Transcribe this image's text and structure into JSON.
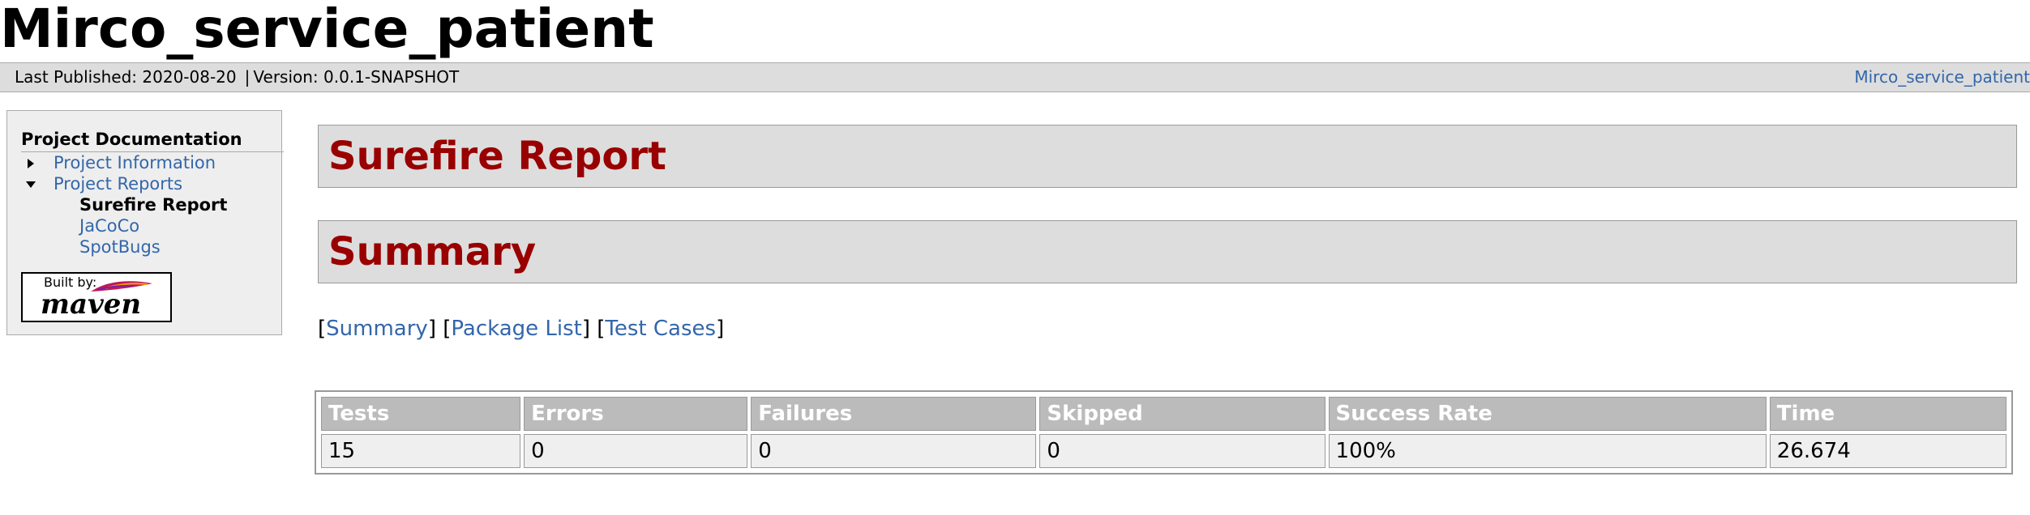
{
  "banner": {
    "title": "Mirco_service_patient"
  },
  "breadcrumbs": {
    "last_published": "Last Published: 2020-08-20",
    "separator": "|",
    "version": "Version: 0.0.1-SNAPSHOT",
    "project_link": "Mirco_service_patient"
  },
  "nav": {
    "heading": "Project Documentation",
    "items": [
      {
        "label": "Project Information",
        "icon": "triangle-right-icon"
      },
      {
        "label": "Project Reports",
        "icon": "triangle-down-icon"
      }
    ],
    "subitems": [
      {
        "label": "Surefire Report",
        "current": true
      },
      {
        "label": "JaCoCo"
      },
      {
        "label": "SpotBugs"
      }
    ]
  },
  "powered_by": {
    "built_by": "Built by:",
    "maven": "maven"
  },
  "content": {
    "report_title": "Surefire Report",
    "summary_title": "Summary",
    "anchors": {
      "summary": "Summary",
      "package_list": "Package List",
      "test_cases": "Test Cases"
    }
  },
  "results": {
    "headers": [
      "Tests",
      "Errors",
      "Failures",
      "Skipped",
      "Success Rate",
      "Time"
    ],
    "row": [
      "15",
      "0",
      "0",
      "0",
      "100%",
      "26.674"
    ]
  },
  "colors": {
    "heading_red": "#990000",
    "link_blue": "#3366aa",
    "bar_gray": "#dddddd",
    "table_header_gray": "#bbbbbb"
  }
}
